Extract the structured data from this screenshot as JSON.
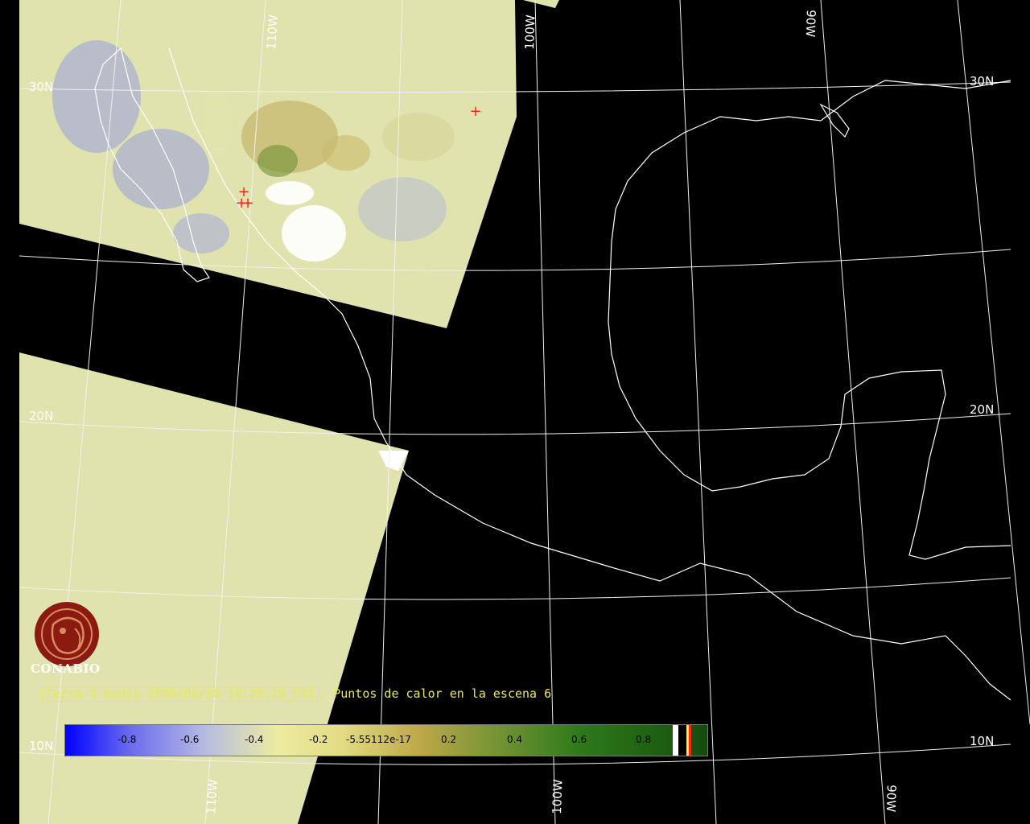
{
  "map": {
    "graticule_labels": {
      "lon_110w_top": "110W",
      "lon_100w_top": "100W",
      "lon_90w_top": "90W",
      "lon_110w_bottom": "110W",
      "lon_100w_bottom": "100W",
      "lon_90w_bottom": "90W",
      "lat_30n_left": "30N",
      "lat_30n_right": "30N",
      "lat_20n_left": "20N",
      "lat_20n_right": "20N",
      "lat_10n_left": "10N",
      "lat_10n_right": "10N"
    },
    "hotspot_marker": "+"
  },
  "caption": {
    "boxed_part": "Terra-1 modis 2009/06/18 18:20:20 CVI",
    "rest": ", Puntos de calor en la escena 6"
  },
  "colorbar": {
    "ticks": [
      "-0.8",
      "-0.6",
      "-0.4",
      "-0.2",
      "-5.55112e-17",
      "0.2",
      "0.4",
      "0.6",
      "0.8"
    ]
  },
  "logo": {
    "name": "CONABIO"
  },
  "colors": {
    "background": "#000000",
    "land_outline": "#ffffff",
    "swath": "#e2e4b0",
    "caption": "#e8e85a",
    "hotspot": "#ff2020",
    "logo": "#8b1a10"
  }
}
